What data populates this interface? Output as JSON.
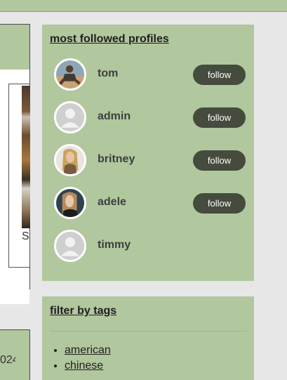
{
  "left_column": {
    "photo_caption": "S",
    "year_fragment": "024"
  },
  "profiles": {
    "title": "most followed profiles",
    "items": [
      {
        "name": "tom",
        "avatar": "photo",
        "follow_label": "follow"
      },
      {
        "name": "admin",
        "avatar": "default-user-icon",
        "follow_label": "follow"
      },
      {
        "name": "britney",
        "avatar": "photo",
        "follow_label": "follow"
      },
      {
        "name": "adele",
        "avatar": "photo",
        "follow_label": "follow"
      },
      {
        "name": "timmy",
        "avatar": "default-user-icon",
        "follow_label": null
      }
    ]
  },
  "tags": {
    "title": "filter by tags",
    "items": [
      "american",
      "chinese"
    ]
  },
  "colors": {
    "card_green": "#b1c79e",
    "button_dark": "#454b3d",
    "page_bg": "#e8e7e8"
  }
}
